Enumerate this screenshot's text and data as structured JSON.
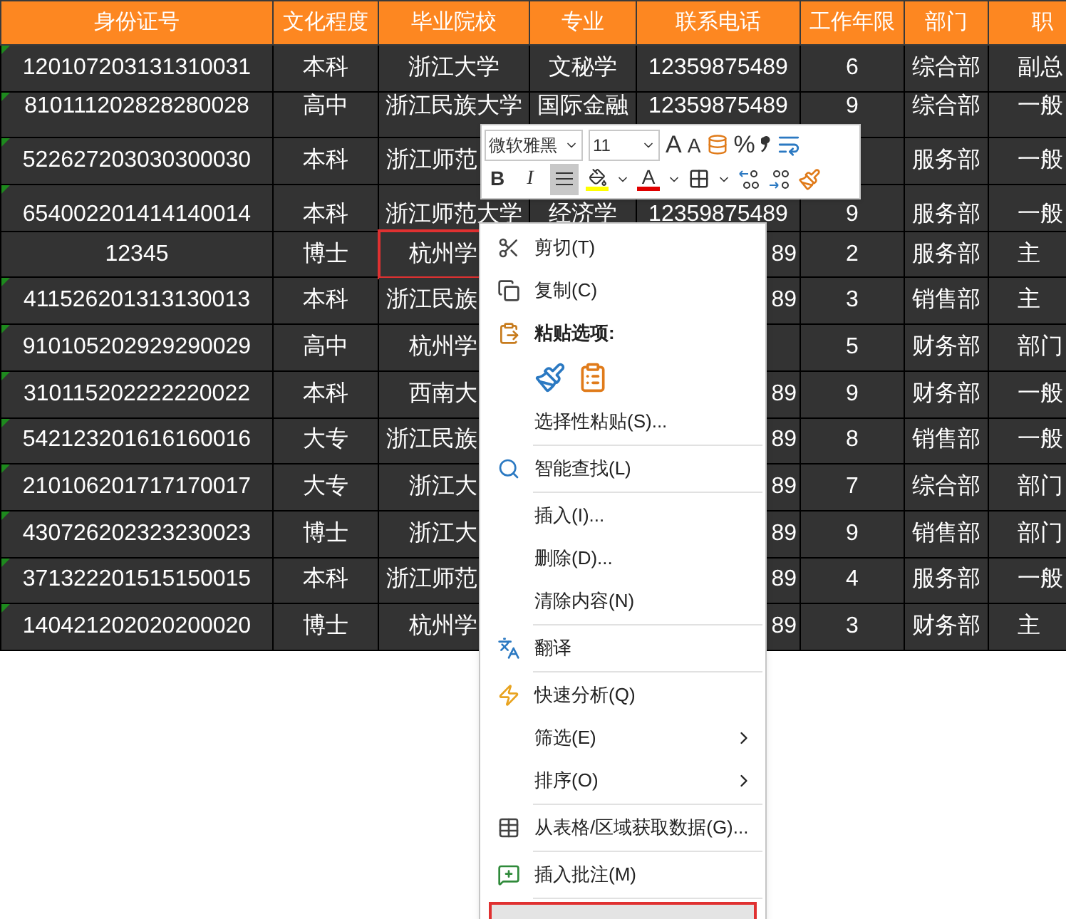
{
  "table": {
    "columns": [
      "身份证号",
      "文化程度",
      "毕业院校",
      "专业",
      "联系电话",
      "工作年限",
      "部门",
      "职"
    ],
    "rows": [
      {
        "error_flag": true,
        "selected": false,
        "cells": [
          "120107203131310031",
          "本科",
          "浙江大学",
          "文秘学",
          "12359875489",
          "6",
          "综合部",
          "副总"
        ]
      },
      {
        "error_flag": true,
        "selected": false,
        "cells": [
          "810111202828280028",
          "高中",
          "浙江民族大学",
          "国际金融",
          "12359875489",
          "9",
          "综合部",
          "一般"
        ]
      },
      {
        "error_flag": true,
        "selected": false,
        "cells": [
          "522627203030300030",
          "本科",
          "浙江师范",
          "",
          "",
          "",
          "服务部",
          "一般"
        ]
      },
      {
        "error_flag": true,
        "selected": false,
        "cells": [
          "654002201414140014",
          "本科",
          "浙江师范大学",
          "经济学",
          "12359875489",
          "9",
          "服务部",
          "一般"
        ]
      },
      {
        "error_flag": false,
        "selected": true,
        "cells": [
          "12345",
          "博士",
          "杭州学",
          "",
          "89",
          "2",
          "服务部",
          "主"
        ]
      },
      {
        "error_flag": true,
        "selected": false,
        "cells": [
          "411526201313130013",
          "本科",
          "浙江民族",
          "",
          "89",
          "3",
          "销售部",
          "主"
        ]
      },
      {
        "error_flag": true,
        "selected": false,
        "cells": [
          "910105202929290029",
          "高中",
          "杭州学",
          "",
          "",
          "5",
          "财务部",
          "部门"
        ]
      },
      {
        "error_flag": true,
        "selected": false,
        "cells": [
          "310115202222220022",
          "本科",
          "西南大",
          "",
          "89",
          "9",
          "财务部",
          "一般"
        ]
      },
      {
        "error_flag": true,
        "selected": false,
        "cells": [
          "542123201616160016",
          "大专",
          "浙江民族",
          "",
          "89",
          "8",
          "销售部",
          "一般"
        ]
      },
      {
        "error_flag": true,
        "selected": false,
        "cells": [
          "210106201717170017",
          "大专",
          "浙江大",
          "",
          "89",
          "7",
          "综合部",
          "部门"
        ]
      },
      {
        "error_flag": true,
        "selected": false,
        "cells": [
          "430726202323230023",
          "博士",
          "浙江大",
          "",
          "89",
          "9",
          "销售部",
          "部门"
        ]
      },
      {
        "error_flag": true,
        "selected": false,
        "cells": [
          "371322201515150015",
          "本科",
          "浙江师范",
          "",
          "89",
          "4",
          "服务部",
          "一般"
        ]
      },
      {
        "error_flag": true,
        "selected": false,
        "cells": [
          "140421202020200020",
          "博士",
          "杭州学",
          "",
          "89",
          "3",
          "财务部",
          "主"
        ]
      }
    ]
  },
  "mini_toolbar": {
    "font": "微软雅黑",
    "size": "11",
    "grow_font": "A",
    "shrink_font": "A",
    "percent": "%",
    "bold": "B",
    "italic": "I",
    "font_color_letter": "A",
    "center_align_on": true
  },
  "context_menu": [
    {
      "kind": "cut",
      "label": "剪切(T)"
    },
    {
      "kind": "copy",
      "label": "复制(C)"
    },
    {
      "kind": "paste-header",
      "label": "粘贴选项:"
    },
    {
      "kind": "paste-options"
    },
    {
      "kind": "plain",
      "label": "选择性粘贴(S)..."
    },
    {
      "kind": "divider"
    },
    {
      "kind": "lookup",
      "label": "智能查找(L)"
    },
    {
      "kind": "divider"
    },
    {
      "kind": "plain",
      "label": "插入(I)..."
    },
    {
      "kind": "plain",
      "label": "删除(D)..."
    },
    {
      "kind": "plain",
      "label": "清除内容(N)"
    },
    {
      "kind": "divider"
    },
    {
      "kind": "translate",
      "label": "翻译"
    },
    {
      "kind": "divider"
    },
    {
      "kind": "analysis",
      "label": "快速分析(Q)"
    },
    {
      "kind": "submenu",
      "label": "筛选(E)"
    },
    {
      "kind": "submenu",
      "label": "排序(O)"
    },
    {
      "kind": "divider"
    },
    {
      "kind": "table",
      "label": "从表格/区域获取数据(G)..."
    },
    {
      "kind": "divider"
    },
    {
      "kind": "comment",
      "label": "插入批注(M)"
    },
    {
      "kind": "divider"
    },
    {
      "kind": "highlighted"
    }
  ]
}
